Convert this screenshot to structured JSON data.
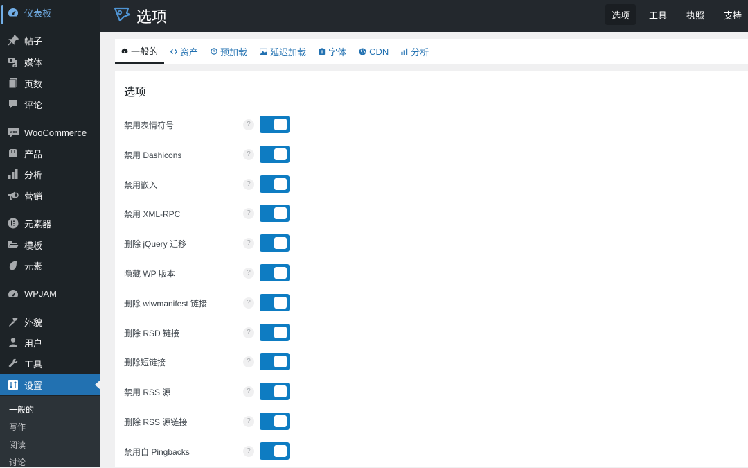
{
  "sidebar": {
    "items": [
      {
        "label": "仪表板",
        "icon": "dashboard-icon"
      },
      {
        "label": "帖子",
        "icon": "pin-icon"
      },
      {
        "label": "媒体",
        "icon": "media-icon"
      },
      {
        "label": "页数",
        "icon": "pages-icon"
      },
      {
        "label": "评论",
        "icon": "comment-icon"
      },
      {
        "label": "WooCommerce",
        "icon": "woo-icon"
      },
      {
        "label": "产品",
        "icon": "archive-icon"
      },
      {
        "label": "分析",
        "icon": "bar-chart-icon"
      },
      {
        "label": "营销",
        "icon": "megaphone-icon"
      },
      {
        "label": "元素器",
        "icon": "elementor-icon"
      },
      {
        "label": "模板",
        "icon": "folder-icon"
      },
      {
        "label": "元素",
        "icon": "leaf-icon"
      },
      {
        "label": "WPJAM",
        "icon": "gauge-icon"
      },
      {
        "label": "外貌",
        "icon": "brush-icon"
      },
      {
        "label": "用户",
        "icon": "user-icon"
      },
      {
        "label": "工具",
        "icon": "wrench-icon"
      },
      {
        "label": "设置",
        "icon": "settings-icon"
      }
    ],
    "submenu": [
      "一般的",
      "写作",
      "阅读",
      "讨论"
    ]
  },
  "header": {
    "title": "选项",
    "nav": [
      "选项",
      "工具",
      "执照",
      "支持"
    ]
  },
  "tabs": [
    {
      "label": "一般的",
      "icon": "dashboard-icon"
    },
    {
      "label": "资产",
      "icon": "code-icon"
    },
    {
      "label": "预加载",
      "icon": "clock-icon"
    },
    {
      "label": "延迟加载",
      "icon": "image-icon"
    },
    {
      "label": "字体",
      "icon": "font-icon"
    },
    {
      "label": "CDN",
      "icon": "globe-icon"
    },
    {
      "label": "分析",
      "icon": "bar-chart-icon"
    }
  ],
  "panel": {
    "title": "选项",
    "help_symbol": "?",
    "options": [
      {
        "label": "禁用表情符号",
        "enabled": true
      },
      {
        "label": "禁用 Dashicons",
        "enabled": true
      },
      {
        "label": "禁用嵌入",
        "enabled": true
      },
      {
        "label": "禁用 XML-RPC",
        "enabled": true
      },
      {
        "label": "删除 jQuery 迁移",
        "enabled": true
      },
      {
        "label": "隐藏 WP 版本",
        "enabled": true
      },
      {
        "label": "删除 wlwmanifest 链接",
        "enabled": true
      },
      {
        "label": "删除 RSD 链接",
        "enabled": true
      },
      {
        "label": "删除短链接",
        "enabled": true
      },
      {
        "label": "禁用 RSS 源",
        "enabled": true
      },
      {
        "label": "删除 RSS 源链接",
        "enabled": true
      },
      {
        "label": "禁用自 Pingbacks",
        "enabled": true
      }
    ]
  },
  "colors": {
    "accent": "#2271b1",
    "toggle_on": "#0e7cc2",
    "sidebar_bg": "#1d2327",
    "topbar_bg": "#23282d"
  }
}
